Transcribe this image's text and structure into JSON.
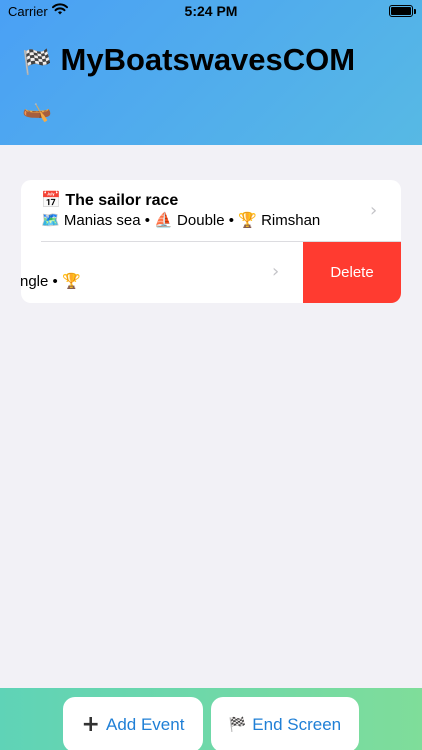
{
  "status_bar": {
    "carrier": "Carrier",
    "time": "5:24 PM",
    "wifi_icon": "wifi-icon",
    "battery_level": 1.0
  },
  "header": {
    "title": "MyBoatswavesCOM",
    "leading_emoji": "🏁",
    "trailing_emoji": "🛶",
    "gradient_start": "#4aa0f5",
    "gradient_end": "#57b9e4"
  },
  "events": [
    {
      "icon": "📅",
      "title": "The sailor race",
      "location_icon": "🗺️",
      "location": "Manias sea",
      "boat_icon": "⛵",
      "boat_type": "Double",
      "trophy_icon": "🏆",
      "winner": "Rimshan"
    },
    {
      "partial_text": "ngle •",
      "trophy_icon": "🏆"
    }
  ],
  "swipe_action": {
    "delete_label": "Delete",
    "color": "#ff3b30"
  },
  "bottom_bar": {
    "add_label": "Add Event",
    "end_label": "End Screen",
    "end_icon": "🏁",
    "gradient_start": "#5fd3b7",
    "gradient_end": "#7fdd9a",
    "accent": "#1f7fd6"
  },
  "separator": "•",
  "chevron": "›"
}
